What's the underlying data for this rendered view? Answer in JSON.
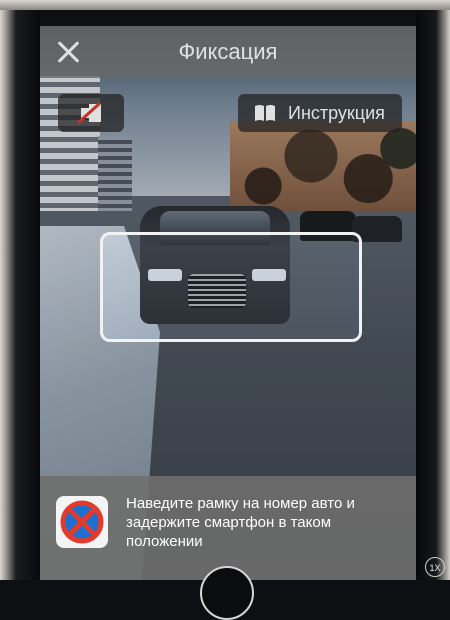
{
  "header": {
    "title": "Фиксация",
    "close_icon": "close-icon"
  },
  "toolbar": {
    "flash_icon": "flash-off-icon",
    "guide_icon": "book-icon",
    "guide_label": "Инструкция"
  },
  "hint": {
    "sign_icon": "no-stopping-sign-icon",
    "text": "Наведите рамку на номер авто и задержите смартфон в таком положении"
  },
  "zoom": {
    "label": "1X"
  },
  "colors": {
    "header_bg": "#787876",
    "overlay_button_bg": "#282828",
    "frame_border": "#f2f2f2",
    "sign_blue": "#1f6fd1",
    "sign_red": "#e23b2c"
  }
}
